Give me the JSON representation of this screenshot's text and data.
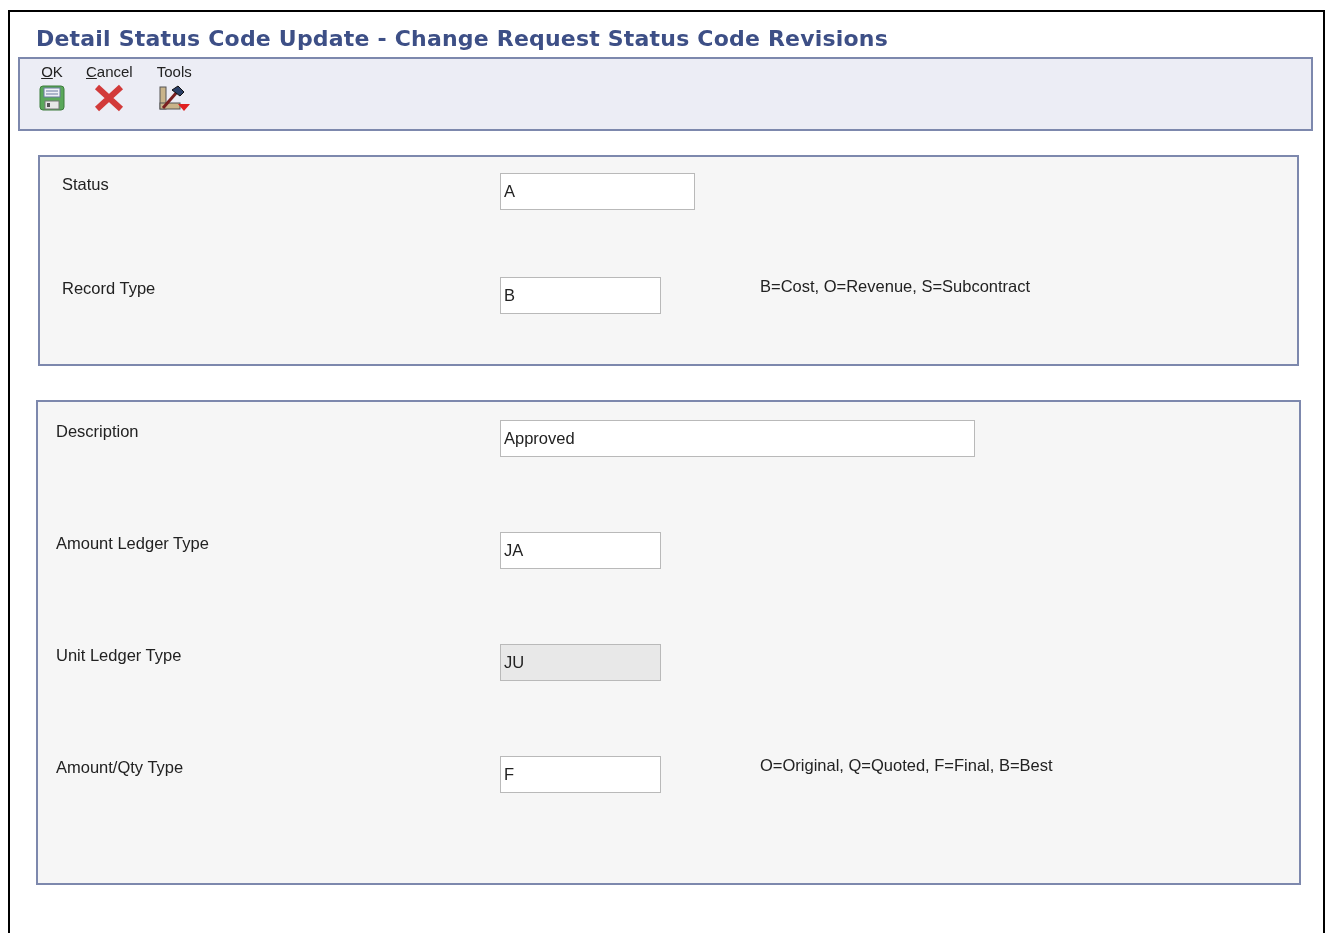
{
  "window": {
    "title": "Detail Status Code Update - Change Request Status Code Revisions"
  },
  "toolbar": [
    {
      "label": "OK",
      "kind": "save",
      "underline_first": true
    },
    {
      "label": "Cancel",
      "kind": "cancel",
      "underline_first": true
    },
    {
      "label": "Tools",
      "kind": "tools",
      "underline_first": false
    }
  ],
  "panels": [
    {
      "fields": [
        {
          "label": "Status",
          "value": "A",
          "kind": "medium",
          "disabled": false
        },
        {
          "label": "Record Type",
          "value": "B",
          "kind": "short",
          "disabled": false,
          "hint": "B=Cost, O=Revenue, S=Subcontract"
        }
      ]
    },
    {
      "fields": [
        {
          "label": "Description",
          "value": "Approved",
          "kind": "long",
          "disabled": false
        },
        {
          "label": "Amount Ledger Type",
          "value": "JA",
          "kind": "short",
          "disabled": false
        },
        {
          "label": "Unit Ledger Type",
          "value": "JU",
          "kind": "short",
          "disabled": true
        },
        {
          "label": "Amount/Qty Type",
          "value": "F",
          "kind": "short",
          "disabled": false,
          "hint": "O=Original, Q=Quoted, F=Final, B=Best"
        }
      ]
    }
  ]
}
